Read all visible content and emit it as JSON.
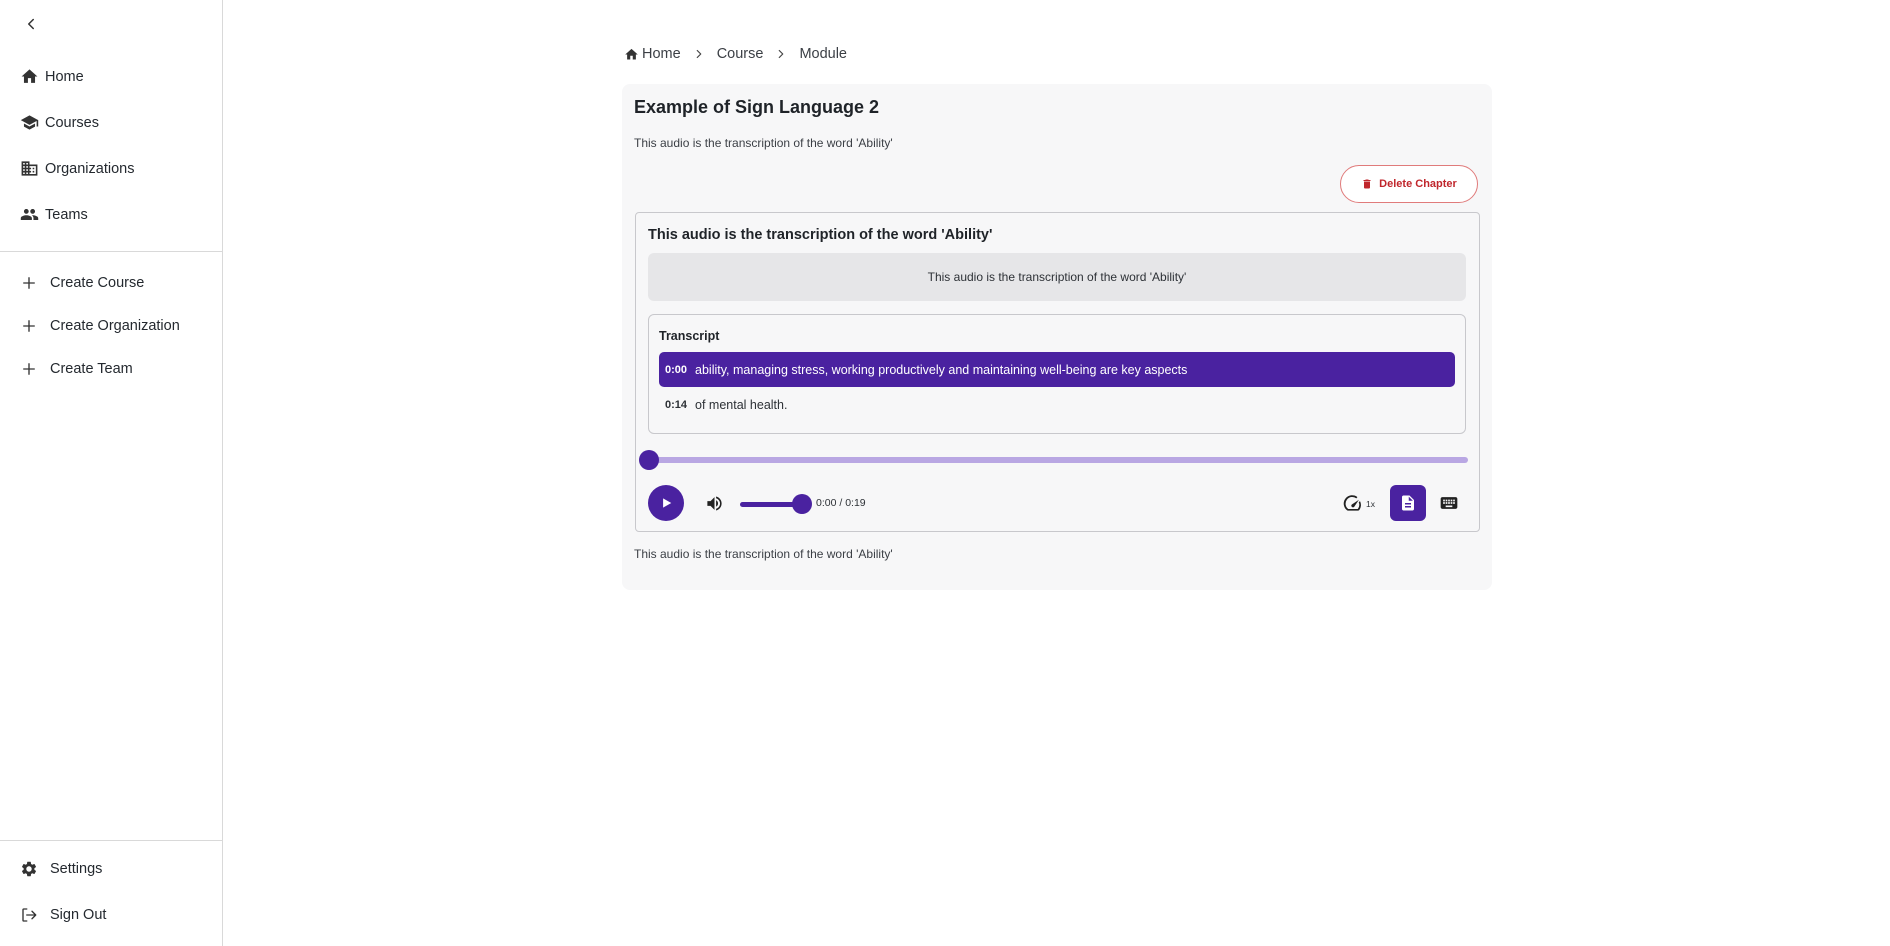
{
  "sidebar": {
    "nav": [
      {
        "label": "Home",
        "icon": "home-icon"
      },
      {
        "label": "Courses",
        "icon": "courses-icon"
      },
      {
        "label": "Organizations",
        "icon": "organizations-icon"
      },
      {
        "label": "Teams",
        "icon": "teams-icon"
      }
    ],
    "create": [
      {
        "label": "Create Course",
        "icon": "plus-icon"
      },
      {
        "label": "Create Organization",
        "icon": "plus-icon"
      },
      {
        "label": "Create Team",
        "icon": "plus-icon"
      }
    ],
    "bottom": [
      {
        "label": "Settings",
        "icon": "gear-icon"
      },
      {
        "label": "Sign Out",
        "icon": "sign-out-icon"
      }
    ]
  },
  "breadcrumb": [
    "Home",
    "Course",
    "Module"
  ],
  "chapter": {
    "title": "Example of Sign Language 2",
    "description": "This audio is the transcription of the word 'Ability'",
    "delete_label": "Delete Chapter",
    "footer_description": "This audio is the transcription of the word 'Ability'"
  },
  "player": {
    "title": "This audio is the transcription of the word 'Ability'",
    "caption": "This audio is the transcription of the word 'Ability'",
    "transcript_title": "Transcript",
    "cues": [
      {
        "time": "0:00",
        "text": "ability, managing stress, working productively and maintaining well-being are key aspects",
        "active": true
      },
      {
        "time": "0:14",
        "text": "of mental health.",
        "active": false
      }
    ],
    "current_time": "0:00",
    "duration": "0:19",
    "time_readout": "0:00 / 0:19",
    "progress": 0,
    "volume": 1,
    "speed": "1x"
  },
  "colors": {
    "accent": "#4a22a0",
    "accent_light": "#b9a7e3",
    "danger": "#c0262c",
    "card_bg": "#f7f7f8"
  }
}
